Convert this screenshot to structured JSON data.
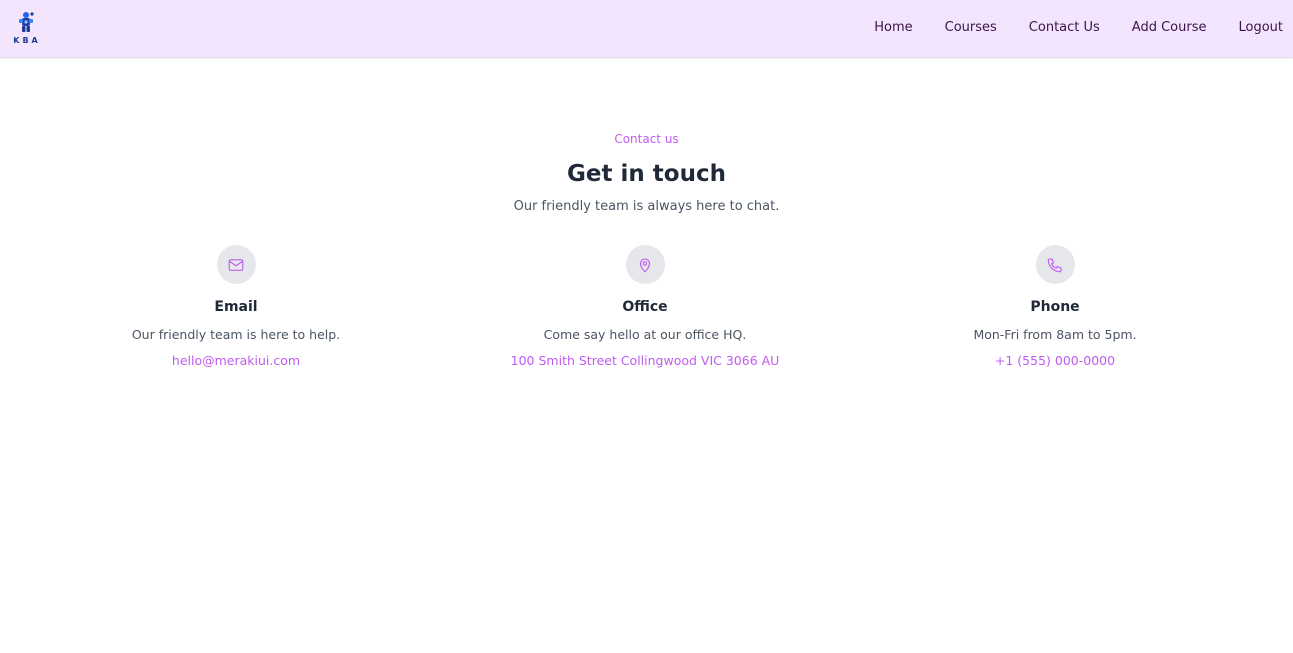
{
  "brand": {
    "logo_text": "KBA",
    "icon": "kba-logo-icon",
    "color": "#1e3a8a"
  },
  "nav": {
    "items": [
      {
        "label": "Home"
      },
      {
        "label": "Courses"
      },
      {
        "label": "Contact Us"
      },
      {
        "label": "Add Course"
      },
      {
        "label": "Logout"
      }
    ]
  },
  "hero": {
    "eyebrow": "Contact us",
    "title": "Get in touch",
    "subtitle": "Our friendly team is always here to chat."
  },
  "cards": [
    {
      "icon": "mail-icon",
      "title": "Email",
      "text": "Our friendly team is here to help.",
      "link": "hello@merakiui.com"
    },
    {
      "icon": "map-pin-icon",
      "title": "Office",
      "text": "Come say hello at our office HQ.",
      "link": "100 Smith Street Collingwood VIC 3066 AU"
    },
    {
      "icon": "phone-icon",
      "title": "Phone",
      "text": "Mon-Fri from 8am to 5pm.",
      "link": "+1 (555) 000-0000"
    }
  ],
  "colors": {
    "navbar_bg": "#f3e5fe",
    "accent": "#c05cf0",
    "icon_circle_bg": "#e5e7eb",
    "heading": "#1f2937",
    "body_text": "#4b5563"
  }
}
